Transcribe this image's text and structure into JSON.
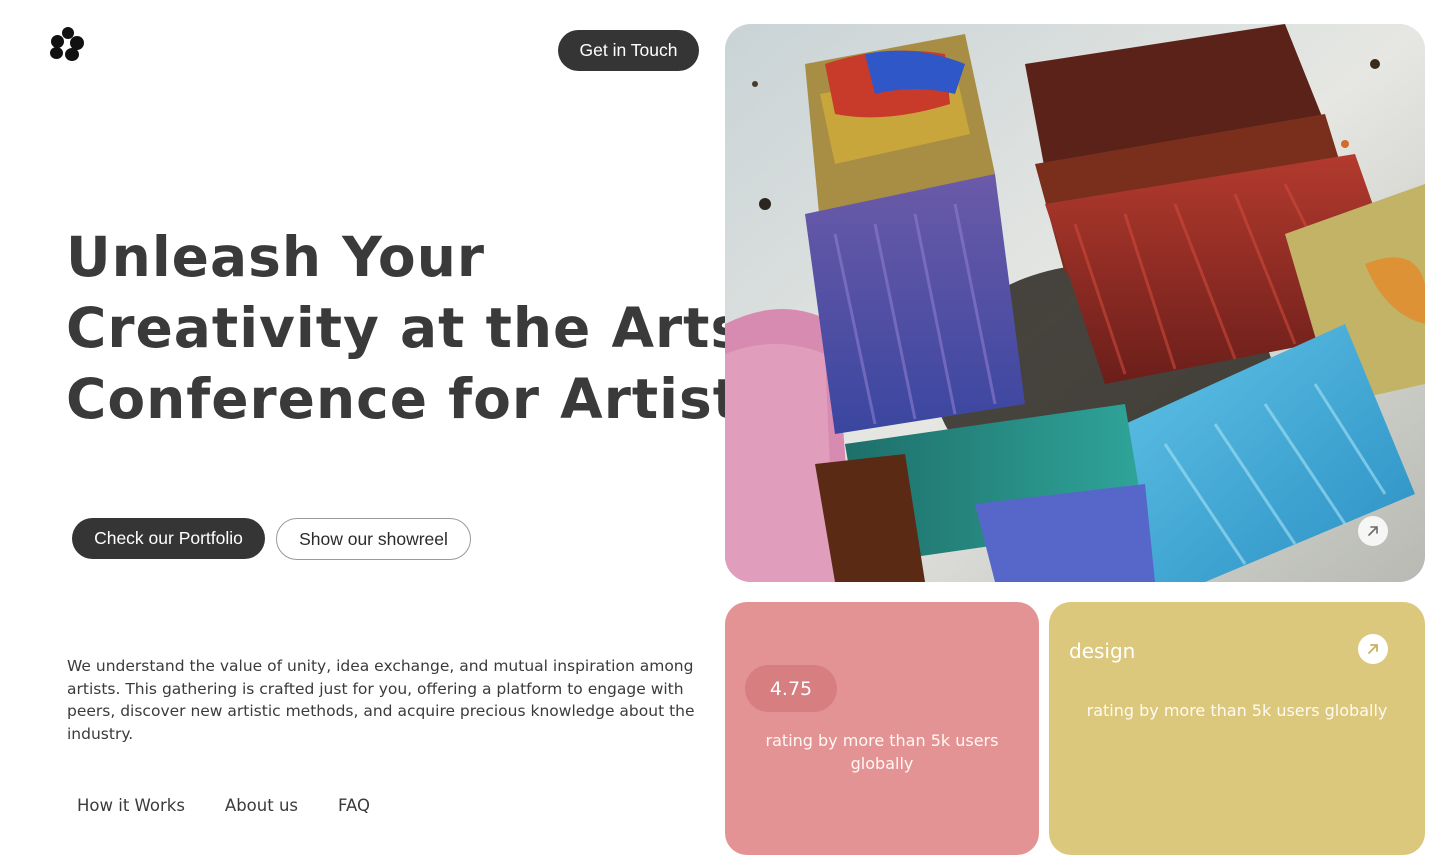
{
  "brand": {
    "logo_icon": "flower-logo-icon"
  },
  "header": {
    "cta_label": "Get in Touch"
  },
  "hero": {
    "headline_lines": [
      "Unleash Your",
      "Creativity at the Arts",
      "Conference for Artists"
    ],
    "primary_button": "Check our Portfolio",
    "secondary_button": "Show our showreel",
    "intro": "We understand the value of unity, idea exchange, and mutual inspiration among artists. This gathering is crafted just for you, offering a platform to engage with peers, discover new artistic methods, and acquire precious knowledge about the industry.",
    "image_icon": "paint-brushes-photo",
    "image_link_icon": "arrow-up-right-icon"
  },
  "footer_nav": {
    "items": [
      "How it Works",
      "About us",
      "FAQ"
    ]
  },
  "cards": {
    "rating": {
      "value": "4.75",
      "caption": "rating by more than 5k users globally",
      "color": "#e49394"
    },
    "design": {
      "title": "design",
      "caption": "rating by more than 5k users globally",
      "color": "#dcc87d",
      "link_icon": "arrow-up-right-icon"
    }
  },
  "colors": {
    "dark_button": "#363535",
    "text": "#3a3a3a"
  }
}
